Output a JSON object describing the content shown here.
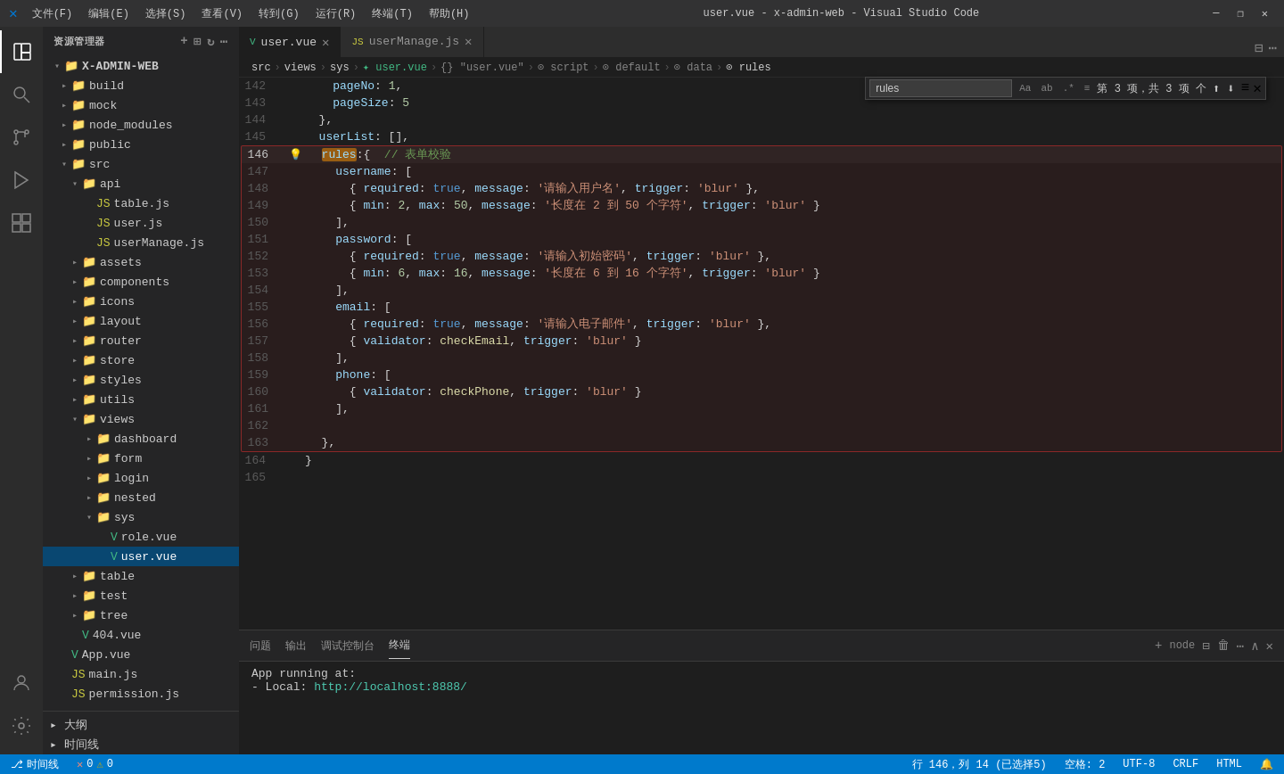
{
  "titleBar": {
    "icon": "✕",
    "menus": [
      "文件(F)",
      "编辑(E)",
      "选择(S)",
      "查看(V)",
      "转到(G)",
      "运行(R)",
      "终端(T)",
      "帮助(H)"
    ],
    "title": "user.vue - x-admin-web - Visual Studio Code",
    "controls": [
      "—",
      "❐",
      "✕"
    ]
  },
  "activityBar": {
    "icons": [
      "⎘",
      "🔍",
      "⎇",
      "🐛",
      "⊞",
      "👤",
      "⚙"
    ]
  },
  "sidebar": {
    "title": "资源管理器",
    "rootLabel": "X-ADMIN-WEB",
    "items": [
      {
        "id": "build",
        "label": "build",
        "type": "folder",
        "indent": 1,
        "expanded": false
      },
      {
        "id": "mock",
        "label": "mock",
        "type": "folder",
        "indent": 1,
        "expanded": false
      },
      {
        "id": "node_modules",
        "label": "node_modules",
        "type": "folder",
        "indent": 1,
        "expanded": false
      },
      {
        "id": "public",
        "label": "public",
        "type": "folder",
        "indent": 1,
        "expanded": false
      },
      {
        "id": "src",
        "label": "src",
        "type": "folder",
        "indent": 1,
        "expanded": true
      },
      {
        "id": "api",
        "label": "api",
        "type": "folder",
        "indent": 2,
        "expanded": true
      },
      {
        "id": "table-js",
        "label": "table.js",
        "type": "js",
        "indent": 3
      },
      {
        "id": "user-js",
        "label": "user.js",
        "type": "js",
        "indent": 3
      },
      {
        "id": "userManage-js",
        "label": "userManage.js",
        "type": "js",
        "indent": 3
      },
      {
        "id": "assets",
        "label": "assets",
        "type": "folder",
        "indent": 2,
        "expanded": false
      },
      {
        "id": "components",
        "label": "components",
        "type": "folder",
        "indent": 2,
        "expanded": false
      },
      {
        "id": "icons",
        "label": "icons",
        "type": "folder",
        "indent": 2,
        "expanded": false
      },
      {
        "id": "layout",
        "label": "layout",
        "type": "folder",
        "indent": 2,
        "expanded": false
      },
      {
        "id": "router",
        "label": "router",
        "type": "folder",
        "indent": 2,
        "expanded": false
      },
      {
        "id": "store",
        "label": "store",
        "type": "folder",
        "indent": 2,
        "expanded": false
      },
      {
        "id": "styles",
        "label": "styles",
        "type": "folder",
        "indent": 2,
        "expanded": false
      },
      {
        "id": "utils",
        "label": "utils",
        "type": "folder",
        "indent": 2,
        "expanded": false
      },
      {
        "id": "views",
        "label": "views",
        "type": "folder",
        "indent": 2,
        "expanded": true
      },
      {
        "id": "dashboard",
        "label": "dashboard",
        "type": "folder",
        "indent": 3,
        "expanded": false
      },
      {
        "id": "form",
        "label": "form",
        "type": "folder",
        "indent": 3,
        "expanded": false
      },
      {
        "id": "login",
        "label": "login",
        "type": "folder",
        "indent": 3,
        "expanded": false
      },
      {
        "id": "nested",
        "label": "nested",
        "type": "folder",
        "indent": 3,
        "expanded": false
      },
      {
        "id": "sys",
        "label": "sys",
        "type": "folder",
        "indent": 3,
        "expanded": true
      },
      {
        "id": "role-vue",
        "label": "role.vue",
        "type": "vue",
        "indent": 4
      },
      {
        "id": "user-vue",
        "label": "user.vue",
        "type": "vue",
        "indent": 4,
        "active": true
      },
      {
        "id": "table",
        "label": "table",
        "type": "folder",
        "indent": 2,
        "expanded": false
      },
      {
        "id": "test",
        "label": "test",
        "type": "folder",
        "indent": 2,
        "expanded": false
      },
      {
        "id": "tree",
        "label": "tree",
        "type": "folder",
        "indent": 2,
        "expanded": false
      },
      {
        "id": "404-vue",
        "label": "404.vue",
        "type": "vue",
        "indent": 2
      },
      {
        "id": "App-vue",
        "label": "App.vue",
        "type": "vue",
        "indent": 1
      },
      {
        "id": "main-js",
        "label": "main.js",
        "type": "js",
        "indent": 1
      },
      {
        "id": "permission-js",
        "label": "permission.js",
        "type": "js",
        "indent": 1
      }
    ],
    "bottom": [
      {
        "id": "dasheng",
        "label": "▸ 大纲",
        "indent": 0
      },
      {
        "id": "timeline",
        "label": "▸ 时间线",
        "indent": 0
      }
    ]
  },
  "tabs": [
    {
      "id": "user-vue",
      "label": "user.vue",
      "type": "vue",
      "active": true,
      "modified": false
    },
    {
      "id": "userManage-js",
      "label": "userManage.js",
      "type": "js",
      "active": false,
      "modified": false
    }
  ],
  "breadcrumb": {
    "items": [
      "src",
      ">",
      "views",
      ">",
      "sys",
      ">",
      "✦ user.vue",
      ">",
      "{} \"user.vue\"",
      ">",
      "⊙ script",
      ">",
      "⊙ default",
      ">",
      "⊙ data",
      ">",
      "⊙ rules"
    ]
  },
  "searchWidget": {
    "value": "rules",
    "count": "第 3 项，共 3 项 个",
    "placeholder": "rules"
  },
  "codeLines": [
    {
      "num": 142,
      "content": "    pageNo: 1,",
      "highlighted": false
    },
    {
      "num": 143,
      "content": "    pageSize: 5",
      "highlighted": false
    },
    {
      "num": 144,
      "content": "  },",
      "highlighted": false
    },
    {
      "num": 145,
      "content": "  userList: [],",
      "highlighted": false
    },
    {
      "num": 146,
      "content": "  rules:{  // 表单校验",
      "highlighted": true,
      "hasBulb": true
    },
    {
      "num": 147,
      "content": "    username: [",
      "highlighted": true
    },
    {
      "num": 148,
      "content": "      { required: true, message: '请输入用户名', trigger: 'blur' },",
      "highlighted": true
    },
    {
      "num": 149,
      "content": "      { min: 2, max: 50, message: '长度在 2 到 50 个字符', trigger: 'blur' }",
      "highlighted": true
    },
    {
      "num": 150,
      "content": "    ],",
      "highlighted": true
    },
    {
      "num": 151,
      "content": "    password: [",
      "highlighted": true
    },
    {
      "num": 152,
      "content": "      { required: true, message: '请输入初始密码', trigger: 'blur' },",
      "highlighted": true
    },
    {
      "num": 153,
      "content": "      { min: 6, max: 16, message: '长度在 6 到 16 个字符', trigger: 'blur' }",
      "highlighted": true
    },
    {
      "num": 154,
      "content": "    ],",
      "highlighted": true
    },
    {
      "num": 155,
      "content": "    email: [",
      "highlighted": true
    },
    {
      "num": 156,
      "content": "      { required: true, message: '请输入电子邮件', trigger: 'blur' },",
      "highlighted": true
    },
    {
      "num": 157,
      "content": "      { validator: checkEmail, trigger: 'blur' }",
      "highlighted": true
    },
    {
      "num": 158,
      "content": "    ],",
      "highlighted": true
    },
    {
      "num": 159,
      "content": "    phone: [",
      "highlighted": true
    },
    {
      "num": 160,
      "content": "      { validator: checkPhone, trigger: 'blur' }",
      "highlighted": true
    },
    {
      "num": 161,
      "content": "    ],",
      "highlighted": true
    },
    {
      "num": 162,
      "content": "",
      "highlighted": true
    },
    {
      "num": 163,
      "content": "  },",
      "highlighted": true
    },
    {
      "num": 164,
      "content": "}",
      "highlighted": false
    },
    {
      "num": 165,
      "content": "",
      "highlighted": false
    }
  ],
  "panel": {
    "tabs": [
      "问题",
      "输出",
      "调试控制台",
      "终端"
    ],
    "activeTab": "终端",
    "terminalContent": "App running at:\n  - Local:   http://localhost:8888/"
  },
  "statusBar": {
    "errors": "0",
    "warnings": "0",
    "branch": "⎇  时间线",
    "encoding": "UTF-8",
    "lineEnding": "CRLF",
    "language": "HTML",
    "lineCol": "行 146，列 14 (已选择5)",
    "spaces": "空格: 2",
    "feedback": "🔔"
  }
}
